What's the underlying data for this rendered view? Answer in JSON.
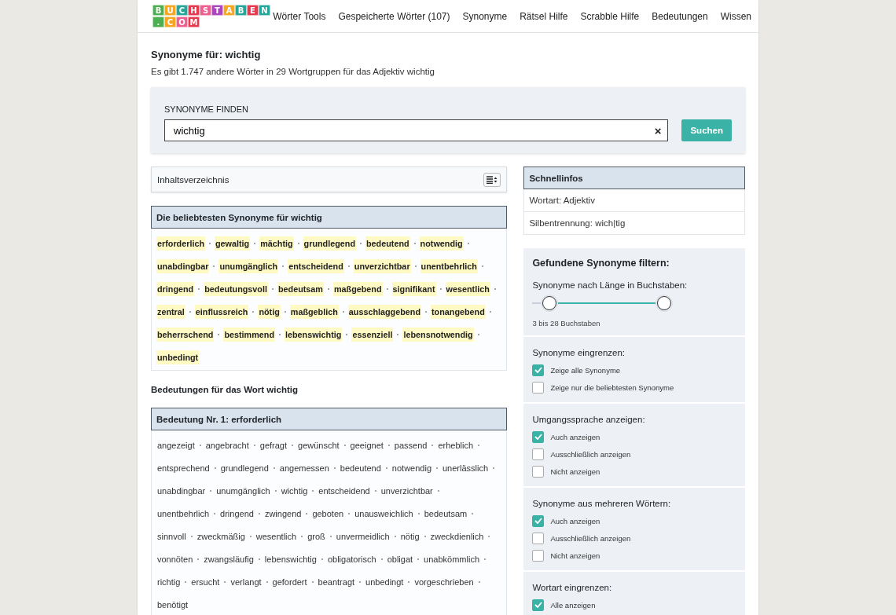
{
  "header": {
    "logo": [
      [
        "B",
        "U",
        "C",
        "H",
        "S",
        "T",
        "A",
        "B",
        "E",
        "N"
      ],
      [
        ".",
        "C",
        "O",
        "M"
      ]
    ],
    "nav": [
      "Wörter Tools",
      "Gespeicherte Wörter (107)",
      "Synonyme",
      "Rätsel Hilfe",
      "Scrabble Hilfe",
      "Bedeutungen",
      "Wissen"
    ]
  },
  "page": {
    "title": "Synonyme für: wichtig",
    "subtitle": "Es gibt 1.747 andere Wörter in 29 Wortgruppen für das Adjektiv wichtig"
  },
  "search": {
    "label": "SYNONYME FINDEN",
    "value": "wichtig",
    "clear": "×",
    "button": "Suchen"
  },
  "toc": {
    "label": "Inhaltsverzeichnis"
  },
  "popular": {
    "heading": "Die beliebtesten Synonyme für wichtig",
    "words": [
      "erforderlich",
      "gewaltig",
      "mächtig",
      "grundlegend",
      "bedeutend",
      "notwendig",
      "unabdingbar",
      "unumgänglich",
      "entscheidend",
      "unverzichtbar",
      "unentbehrlich",
      "dringend",
      "bedeutungsvoll",
      "bedeutsam",
      "maßgebend",
      "signifikant",
      "wesentlich",
      "zentral",
      "einflussreich",
      "nötig",
      "maßgeblich",
      "ausschlaggebend",
      "tonangebend",
      "beherrschend",
      "bestimmend",
      "lebenswichtig",
      "essenziell",
      "lebensnotwendig",
      "unbedingt"
    ]
  },
  "meanings_heading": "Bedeutungen für das Wort wichtig",
  "meanings": [
    {
      "heading": "Bedeutung Nr. 1: erforderlich",
      "words": [
        "angezeigt",
        "angebracht",
        "gefragt",
        "gewünscht",
        "geeignet",
        "passend",
        "erheblich",
        "entsprechend",
        "grundlegend",
        "angemessen",
        "bedeutend",
        "notwendig",
        "unerlässlich",
        "unabdingbar",
        "unumgänglich",
        "wichtig",
        "entscheidend",
        "unverzichtbar",
        "unentbehrlich",
        "dringend",
        "zwingend",
        "geboten",
        "unausweichlich",
        "bedeutsam",
        "sinnvoll",
        "zweckmäßig",
        "wesentlich",
        "groß",
        "unvermeidlich",
        "nötig",
        "zweckdienlich",
        "vonnöten",
        "zwangsläufig",
        "lebenswichtig",
        "obligatorisch",
        "obligat",
        "unabkömmlich",
        "richtig",
        "ersucht",
        "verlangt",
        "gefordert",
        "beantragt",
        "unbedingt",
        "vorgeschrieben",
        "benötigt"
      ]
    }
  ],
  "quick_info": {
    "heading": "Schnellinfos",
    "rows": [
      "Wortart: Adjektiv",
      "Silbentrennung: wich|tig"
    ]
  },
  "filter": {
    "heading": "Gefundene Synonyme filtern:",
    "length": {
      "label": "Synonyme nach Länge in Buchstaben:",
      "thumbs": [
        {
          "level": 0
        },
        {
          "level": 1
        }
      ],
      "reading": "3 bis 28 Buchstaben"
    },
    "groups": [
      {
        "title": "Synonyme eingrenzen:",
        "options": [
          {
            "label": "Zeige alle Synonyme",
            "checked": true
          },
          {
            "label": "Zeige nur die beliebtesten Synonyme",
            "checked": false
          }
        ]
      },
      {
        "title": "Umgangssprache anzeigen:",
        "options": [
          {
            "label": "Auch anzeigen",
            "checked": true
          },
          {
            "label": "Ausschließlich anzeigen",
            "checked": false
          },
          {
            "label": "Nicht anzeigen",
            "checked": false
          }
        ]
      },
      {
        "title": "Synonyme aus mehreren Wörtern:",
        "options": [
          {
            "label": "Auch anzeigen",
            "checked": true
          },
          {
            "label": "Ausschließlich anzeigen",
            "checked": false
          },
          {
            "label": "Nicht anzeigen",
            "checked": false
          }
        ]
      },
      {
        "title": "Wortart eingrenzen:",
        "options": [
          {
            "label": "Alle anzeigen",
            "checked": true
          }
        ]
      }
    ]
  }
}
